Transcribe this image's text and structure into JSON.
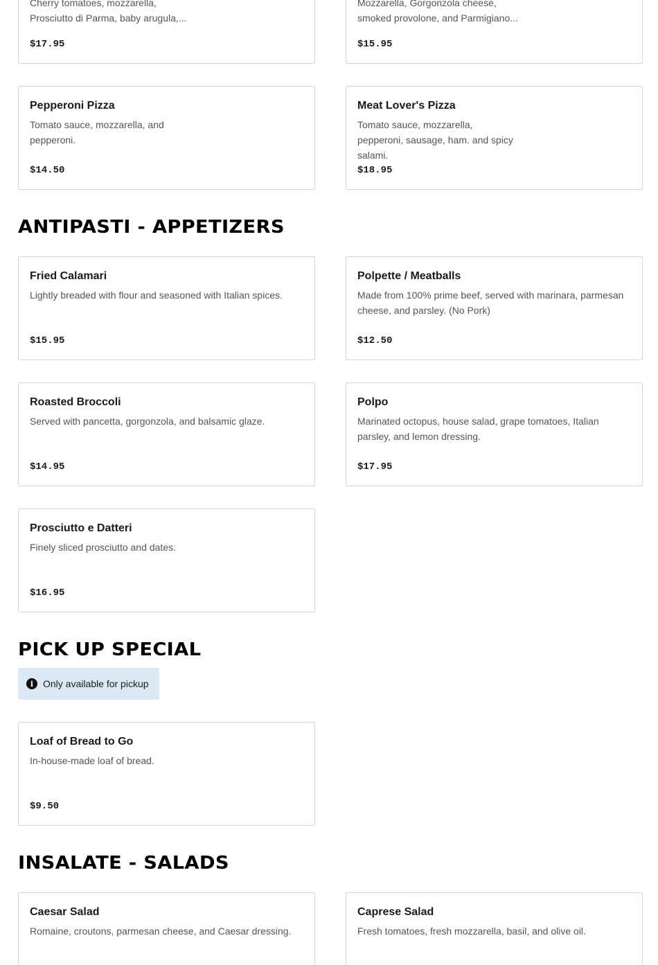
{
  "pizzas": [
    {
      "name": "",
      "description": "Cherry tomatoes, mozzarella, Prosciutto di Parma, baby arugula,...",
      "price": "$17.95"
    },
    {
      "name": "",
      "description": "Mozzarella, Gorgonzola cheese, smoked provolone, and Parmigiano...",
      "price": "$15.95"
    },
    {
      "name": "Pepperoni Pizza",
      "description": "Tomato sauce, mozzarella, and pepperoni.",
      "price": "$14.50"
    },
    {
      "name": "Meat Lover's Pizza",
      "description": "Tomato sauce, mozzarella, pepperoni, sausage, ham. and spicy salami.",
      "price": "$18.95"
    }
  ],
  "sections": {
    "appetizers": {
      "title": "ANTIPASTI - APPETIZERS",
      "items": [
        {
          "name": "Fried Calamari",
          "description": "Lightly breaded with flour and seasoned with Italian spices.",
          "price": "$15.95"
        },
        {
          "name": "Polpette / Meatballs",
          "description": "Made from 100% prime beef, served with marinara, parmesan cheese, and parsley. (No Pork)",
          "price": "$12.50"
        },
        {
          "name": "Roasted Broccoli",
          "description": "Served with pancetta, gorgonzola, and balsamic glaze.",
          "price": "$14.95"
        },
        {
          "name": "Polpo",
          "description": "Marinated octopus, house salad, grape tomatoes, Italian parsley, and lemon dressing.",
          "price": "$17.95"
        },
        {
          "name": "Prosciutto e Datteri",
          "description": "Finely sliced prosciutto and dates.",
          "price": "$16.95"
        }
      ]
    },
    "pickup": {
      "title": "PICK UP SPECIAL",
      "notice": "Only available for pickup",
      "notice_icon": "info-icon",
      "items": [
        {
          "name": "Loaf of Bread to Go",
          "description": "In-house-made loaf of bread.",
          "price": "$9.50"
        }
      ]
    },
    "salads": {
      "title": "INSALATE - SALADS",
      "items": [
        {
          "name": "Caesar Salad",
          "description": "Romaine, croutons, parmesan cheese, and Caesar dressing.",
          "price": ""
        },
        {
          "name": "Caprese Salad",
          "description": "Fresh tomatoes, fresh mozzarella, basil, and olive oil.",
          "price": ""
        }
      ]
    }
  },
  "colors": {
    "notice_bg": "#dde8f5",
    "card_border": "#d6d6d6",
    "description": "#555555"
  }
}
